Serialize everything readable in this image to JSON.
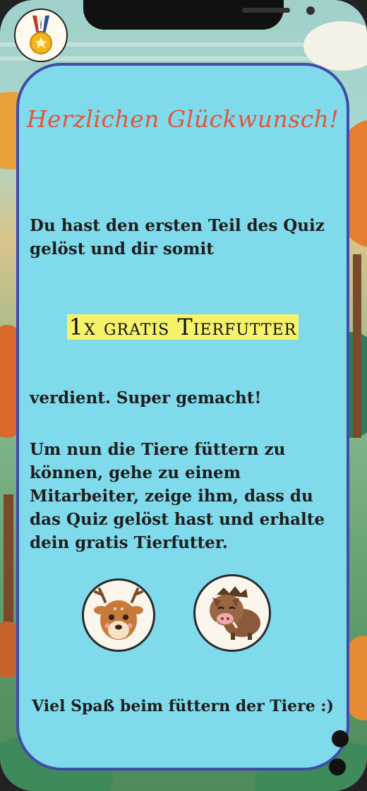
{
  "card": {
    "headline": "Herzlichen Glückwunsch!",
    "intro": "Du hast den ersten Teil des Quiz gelöst und dir somit",
    "reward": "1x gratis Tierfutter",
    "earned": "verdient. Super gemacht!",
    "instructions": "Um nun die Tiere füttern zu können, gehe zu einem Mitarbeiter, zeige ihm, dass du das Quiz gelöst hast und erhalte dein gratis Tierfutter.",
    "footer": "Viel Spaß beim füttern der Tiere :)"
  },
  "icons": {
    "medal": "medal-icon",
    "deer": "deer-icon",
    "boar": "boar-icon"
  },
  "colors": {
    "card_background": "#7fdaeb",
    "card_border": "#3f4da6",
    "headline": "#e1573a",
    "highlight": "#f6f26a"
  }
}
